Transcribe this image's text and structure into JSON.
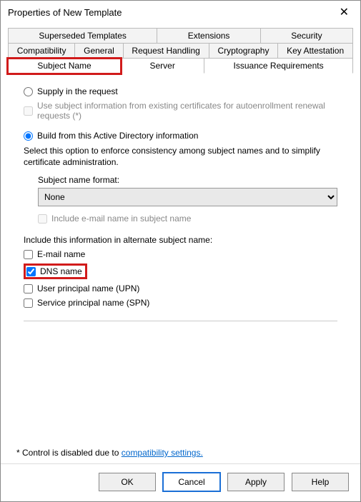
{
  "window": {
    "title": "Properties of New Template"
  },
  "tabs": {
    "row1": [
      "Superseded Templates",
      "Extensions",
      "Security"
    ],
    "row2": [
      "Compatibility",
      "General",
      "Request Handling",
      "Cryptography",
      "Key Attestation"
    ],
    "row3": [
      "Subject Name",
      "Server",
      "Issuance Requirements"
    ]
  },
  "supply": {
    "radio": "Supply in the request",
    "sub_chk": "Use subject information from existing certificates for autoenrollment renewal requests (*)"
  },
  "build": {
    "radio": "Build from this Active Directory information",
    "desc": "Select this option to enforce consistency among subject names and to simplify certificate administration.",
    "format_label": "Subject name format:",
    "format_value": "None",
    "include_email_chk": "Include e-mail name in subject name",
    "alt_label": "Include this information in alternate subject name:",
    "alt": {
      "email": "E-mail name",
      "dns": "DNS name",
      "upn": "User principal name (UPN)",
      "spn": "Service principal name (SPN)"
    }
  },
  "footer": {
    "note_prefix": "* Control is disabled due to ",
    "link": "compatibility settings."
  },
  "buttons": {
    "ok": "OK",
    "cancel": "Cancel",
    "apply": "Apply",
    "help": "Help"
  }
}
